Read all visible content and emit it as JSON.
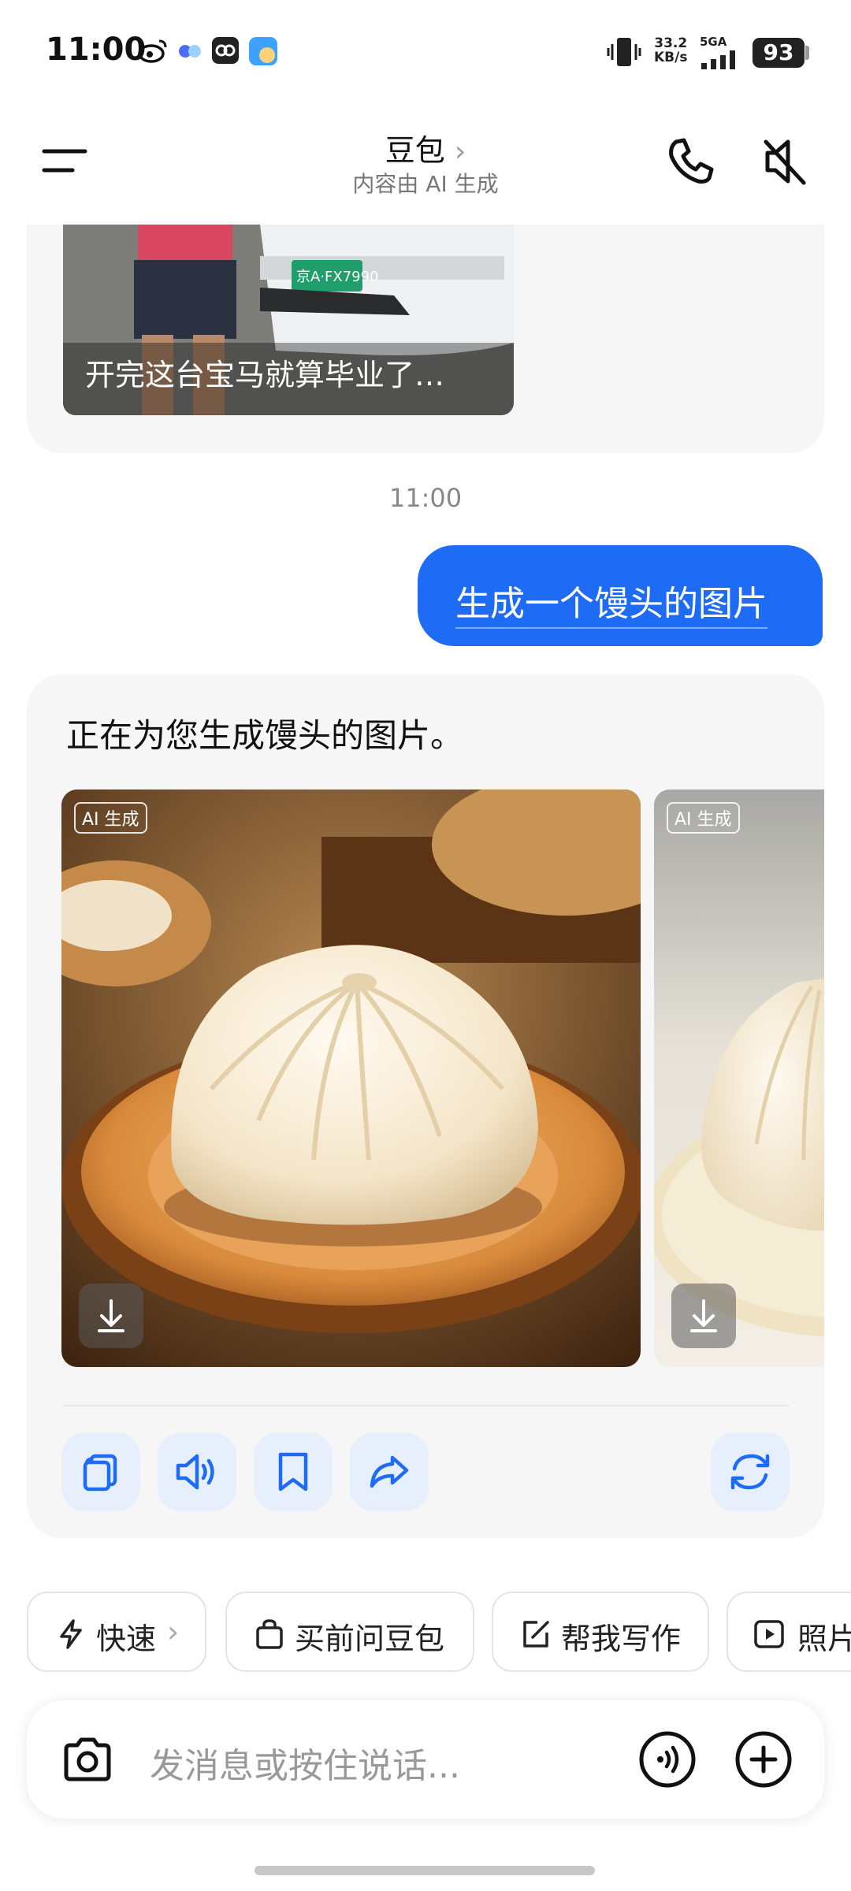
{
  "status_bar": {
    "time": "11:00",
    "net_speed_value": "33.2",
    "net_speed_unit": "KB/s",
    "network_type": "5GA",
    "battery": "93"
  },
  "header": {
    "title": "豆包",
    "title_chevron": "›",
    "subtitle": "内容由 AI 生成"
  },
  "previous_message": {
    "caption": "开完这台宝马就算毕业了…",
    "plate": "京A·FX7990"
  },
  "timestamp": "11:00",
  "user_message": "生成一个馒头的图片",
  "bot_message": {
    "text": "正在为您生成馒头的图片。",
    "ai_tag": "AI 生成"
  },
  "actions": {
    "copy": "copy-icon",
    "speak": "speaker-icon",
    "bookmark": "bookmark-icon",
    "share": "share-icon",
    "regenerate": "refresh-icon"
  },
  "chips": [
    {
      "label": "快速",
      "icon": "lightning-icon"
    },
    {
      "label": "买前问豆包",
      "icon": "shopping-bag-icon"
    },
    {
      "label": "帮我写作",
      "icon": "edit-icon"
    },
    {
      "label": "照片",
      "icon": "play-icon"
    }
  ],
  "input": {
    "placeholder": "发消息或按住说话..."
  },
  "colors": {
    "accent": "#1e6cf6",
    "card_bg": "#f6f6f7",
    "action_bg": "#e7eefc"
  }
}
